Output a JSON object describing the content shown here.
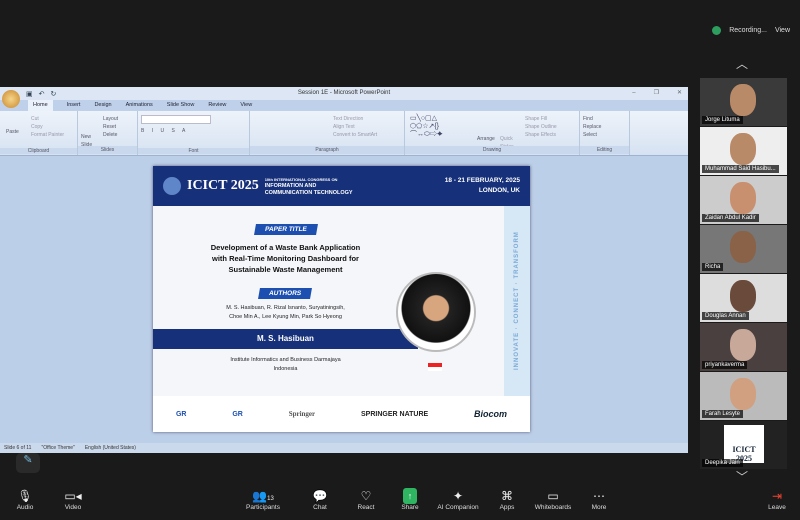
{
  "topbar": {
    "recording": "Recording...",
    "view": "View"
  },
  "ppt": {
    "title": "Session 1E - Microsoft PowerPoint",
    "tabs": [
      "Home",
      "Insert",
      "Design",
      "Animations",
      "Slide Show",
      "Review",
      "View"
    ],
    "groups": [
      "Clipboard",
      "Slides",
      "Font",
      "Paragraph",
      "Drawing",
      "Editing"
    ],
    "clipboard": {
      "paste": "Paste",
      "cut": "Cut",
      "copy": "Copy",
      "format": "Format Painter"
    },
    "slides": {
      "new": "New Slide",
      "layout": "Layout",
      "reset": "Reset",
      "delete": "Delete"
    },
    "drawing": {
      "arrange": "Arrange",
      "quick": "Quick Styles",
      "fill": "Shape Fill",
      "outline": "Shape Outline",
      "effects": "Shape Effects"
    },
    "paragraph": {
      "dir": "Text Direction",
      "align": "Align Text",
      "smart": "Convert to SmartArt"
    },
    "editing": {
      "find": "Find",
      "replace": "Replace",
      "select": "Select"
    },
    "status": {
      "slide": "Slide 6 of 11",
      "theme": "\"Office Theme\"",
      "lang": "English (United States)"
    }
  },
  "slide": {
    "brand": "ICICT 2025",
    "conf_line1": "10th INTERNATIONAL CONGRESS ON",
    "conf_line2": "INFORMATION AND",
    "conf_line3": "COMMUNICATION TECHNOLOGY",
    "dates": "18 - 21 FEBRUARY, 2025",
    "place": "LONDON, UK",
    "paper_label": "PAPER TITLE",
    "paper_title": [
      "Development of a Waste Bank Application",
      "with Real-Time Monitoring Dashboard for",
      "Sustainable Waste Management"
    ],
    "authors_label": "AUTHORS",
    "authors": [
      "M. S. Hasibuan, R. Rizal Isnanto, Suryatiningsih,",
      "Choe Min A., Lee Kyung Min, Park So Hyeong"
    ],
    "presenter": "M. S. Hasibuan",
    "affiliation": [
      "Institute Informatics and Business Darmajaya",
      "Indonesia"
    ],
    "vertical": "INNOVATE · CONNECT · TRANSFORM",
    "sponsors": [
      "GR",
      "GR",
      "Springer",
      "SPRINGER NATURE",
      "Biocom"
    ]
  },
  "participants": [
    "Jorge Lituma",
    "Muhammad Said Hasibu...",
    "Zaidan Abdul Kadir",
    "Richa",
    "Douglas Annan",
    "priyankaverma",
    "Farah Lesyte",
    "Deepika Jain"
  ],
  "toolbar": [
    {
      "label": "Audio",
      "icon": "mic-icon"
    },
    {
      "label": "Video",
      "icon": "video-icon"
    },
    {
      "label": "Participants",
      "icon": "participants-icon",
      "count": "13"
    },
    {
      "label": "Chat",
      "icon": "chat-icon"
    },
    {
      "label": "React",
      "icon": "heart-icon"
    },
    {
      "label": "Share",
      "icon": "share-icon"
    },
    {
      "label": "AI Companion",
      "icon": "sparkle-icon"
    },
    {
      "label": "Apps",
      "icon": "apps-icon"
    },
    {
      "label": "Whiteboards",
      "icon": "whiteboard-icon"
    },
    {
      "label": "More",
      "icon": "more-icon"
    },
    {
      "label": "Leave",
      "icon": "leave-icon"
    }
  ],
  "colors": {
    "navy": "#16307a",
    "share": "#2fb462",
    "leave": "#e43"
  }
}
